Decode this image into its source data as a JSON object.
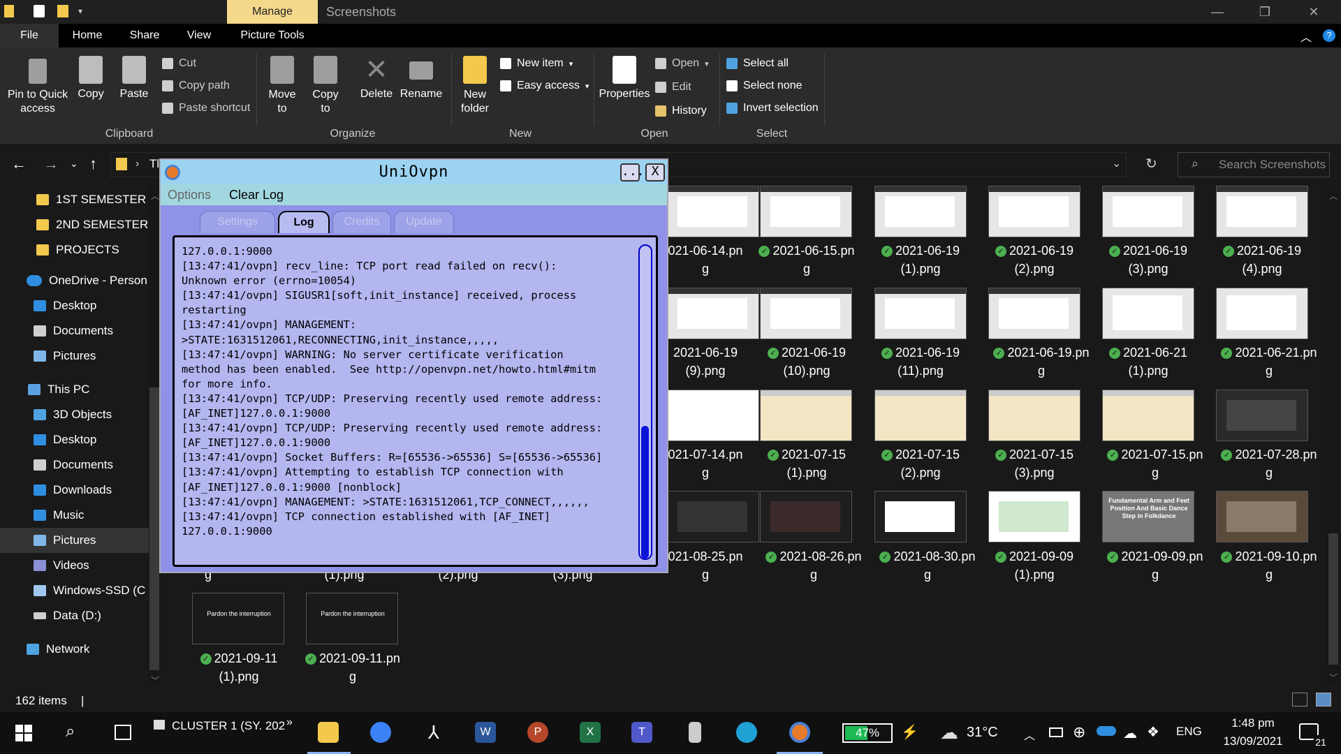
{
  "titlebar": {
    "manage_tab": "Manage",
    "window_title": "Screenshots"
  },
  "ribbon_tabs": [
    "File",
    "Home",
    "Share",
    "View",
    "Picture Tools"
  ],
  "ribbon": {
    "clipboard": {
      "pin": "Pin to Quick access",
      "copy": "Copy",
      "paste": "Paste",
      "cut": "Cut",
      "copy_path": "Copy path",
      "paste_shortcut": "Paste shortcut",
      "label": "Clipboard"
    },
    "organize": {
      "move_to": "Move to",
      "copy_to": "Copy to",
      "delete": "Delete",
      "rename": "Rename",
      "label": "Organize"
    },
    "new": {
      "new_folder": "New folder",
      "new_item": "New item",
      "easy_access": "Easy access",
      "label": "New"
    },
    "open": {
      "properties": "Properties",
      "open": "Open",
      "edit": "Edit",
      "history": "History",
      "label": "Open"
    },
    "select": {
      "select_all": "Select all",
      "select_none": "Select none",
      "invert": "Invert selection",
      "label": "Select"
    }
  },
  "address": {
    "crumb": "Tl",
    "search_placeholder": "Search Screenshots"
  },
  "nav": [
    {
      "label": "1ST SEMESTER",
      "icon": "folder-icon"
    },
    {
      "label": "2ND SEMESTER",
      "icon": "folder-icon"
    },
    {
      "label": "PROJECTS",
      "icon": "folder-icon"
    },
    {
      "label": "OneDrive - Person",
      "icon": "onedrive-icon"
    },
    {
      "label": "Desktop",
      "icon": "desktop-icon"
    },
    {
      "label": "Documents",
      "icon": "documents-icon"
    },
    {
      "label": "Pictures",
      "icon": "pictures-icon"
    },
    {
      "label": "This PC",
      "icon": "pc-icon"
    },
    {
      "label": "3D Objects",
      "icon": "3d-objects-icon"
    },
    {
      "label": "Desktop",
      "icon": "desktop-icon"
    },
    {
      "label": "Documents",
      "icon": "documents-icon"
    },
    {
      "label": "Downloads",
      "icon": "downloads-icon"
    },
    {
      "label": "Music",
      "icon": "music-icon"
    },
    {
      "label": "Pictures",
      "icon": "pictures-icon"
    },
    {
      "label": "Videos",
      "icon": "videos-icon"
    },
    {
      "label": "Windows-SSD (C",
      "icon": "drive-icon"
    },
    {
      "label": "Data (D:)",
      "icon": "drive-icon"
    },
    {
      "label": "Network",
      "icon": "network-icon"
    }
  ],
  "files": {
    "row1": [
      {
        "l1": "021-06-14.pn",
        "l2": "g"
      },
      {
        "l1": "2021-06-15.pn",
        "l2": "g"
      },
      {
        "l1": "2021-06-19",
        "l2": "(1).png"
      },
      {
        "l1": "2021-06-19",
        "l2": "(2).png"
      },
      {
        "l1": "2021-06-19",
        "l2": "(3).png"
      },
      {
        "l1": "2021-06-19",
        "l2": "(4).png"
      }
    ],
    "row2": [
      {
        "l1": "2021-06-19",
        "l2": "(9).png"
      },
      {
        "l1": "2021-06-19",
        "l2": "(10).png"
      },
      {
        "l1": "2021-06-19",
        "l2": "(11).png"
      },
      {
        "l1": "2021-06-19.pn",
        "l2": "g"
      },
      {
        "l1": "2021-06-21",
        "l2": "(1).png"
      },
      {
        "l1": "2021-06-21.pn",
        "l2": "g"
      }
    ],
    "row3": [
      {
        "l1": "021-07-14.pn",
        "l2": "g"
      },
      {
        "l1": "2021-07-15",
        "l2": "(1).png"
      },
      {
        "l1": "2021-07-15",
        "l2": "(2).png"
      },
      {
        "l1": "2021-07-15",
        "l2": "(3).png"
      },
      {
        "l1": "2021-07-15.pn",
        "l2": "g"
      },
      {
        "l1": "2021-07-28.pn",
        "l2": "g"
      }
    ],
    "row4": [
      {
        "l1": "021-08-25.pn",
        "l2": "g"
      },
      {
        "l1": "2021-08-26.pn",
        "l2": "g"
      },
      {
        "l1": "2021-08-30.pn",
        "l2": "g"
      },
      {
        "l1": "2021-09-09",
        "l2": "(1).png"
      },
      {
        "l1": "2021-09-09.pn",
        "l2": "g"
      },
      {
        "l1": "2021-09-10.pn",
        "l2": "g"
      }
    ],
    "row4_left": [
      "g",
      "(1).png",
      "(2).png",
      "(3).png"
    ],
    "row5": [
      {
        "l1": "2021-09-11",
        "l2": "(1).png",
        "caption": "Pardon the interruption"
      },
      {
        "l1": "2021-09-11.pn",
        "l2": "g",
        "caption": "Pardon the interruption"
      }
    ],
    "thumb_caption_folk": "Fundamental Arm and Feet Position And Basic Dance Step in Folkdance"
  },
  "status": {
    "items": "162 items"
  },
  "dialog": {
    "title": "UniOvpn",
    "min_btn": "...",
    "close_btn": "X",
    "menu": [
      "Options",
      "Clear Log"
    ],
    "tabs": [
      "Settings",
      "Log",
      "Credits",
      "Update"
    ],
    "log_lines": [
      "127.0.0.1:9000",
      "[13:47:41/ovpn] recv_line: TCP port read failed on recv():",
      "Unknown error (errno=10054)",
      "[13:47:41/ovpn] SIGUSR1[soft,init_instance] received, process",
      "restarting",
      "[13:47:41/ovpn] MANAGEMENT:",
      ">STATE:1631512061,RECONNECTING,init_instance,,,,,",
      "[13:47:41/ovpn] WARNING: No server certificate verification",
      "method has been enabled.  See http://openvpn.net/howto.html#mitm",
      "for more info.",
      "[13:47:41/ovpn] TCP/UDP: Preserving recently used remote address:",
      "[AF_INET]127.0.0.1:9000",
      "[13:47:41/ovpn] TCP/UDP: Preserving recently used remote address:",
      "[AF_INET]127.0.0.1:9000",
      "[13:47:41/ovpn] Socket Buffers: R=[65536->65536] S=[65536->65536]",
      "[13:47:41/ovpn] Attempting to establish TCP connection with",
      "[AF_INET]127.0.0.1:9000 [nonblock]",
      "[13:47:41/ovpn] MANAGEMENT: >STATE:1631512061,TCP_CONNECT,,,,,,",
      "[13:47:41/ovpn] TCP connection established with [AF_INET]",
      "127.0.0.1:9000"
    ]
  },
  "taskbar": {
    "cluster_label": "CLUSTER 1 (SY. 202",
    "battery": "47%",
    "temp": "31°C",
    "lang": "ENG",
    "time": "1:48 pm",
    "date": "13/09/2021",
    "notif_count": "21"
  },
  "colors": {
    "accent": "#0078d7",
    "manage_tab": "#f4d88b",
    "dialog_bg": "#8f92e6",
    "dialog_title": "#9bd3f0",
    "check": "#4caf50"
  }
}
